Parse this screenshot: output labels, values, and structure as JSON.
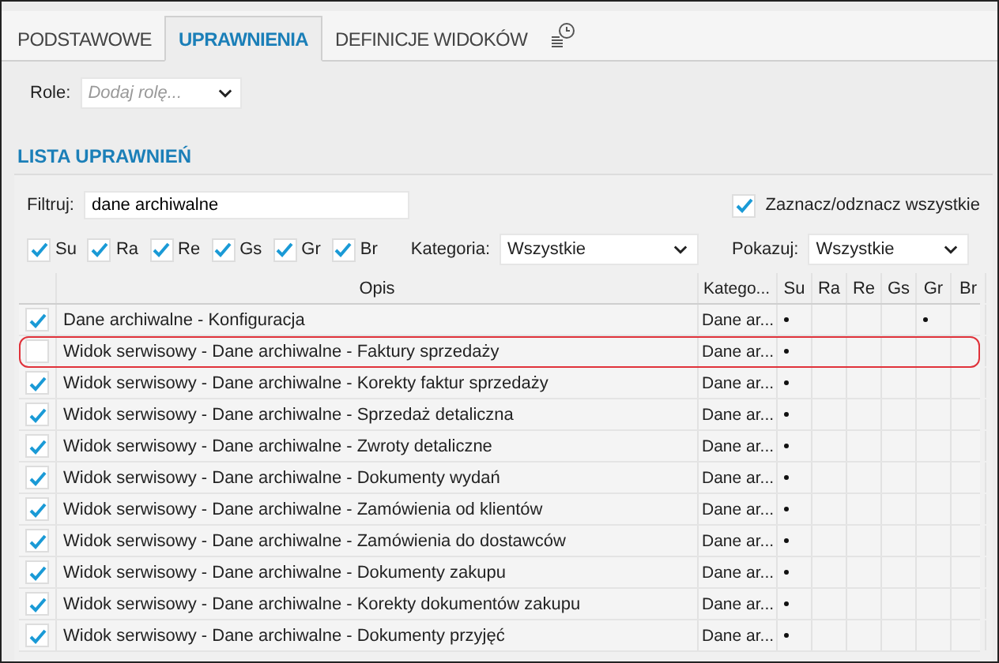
{
  "tabs": [
    {
      "label": "PODSTAWOWE",
      "selected": false
    },
    {
      "label": "UPRAWNIENIA",
      "selected": true
    },
    {
      "label": "DEFINICJE WIDOKÓW",
      "selected": false
    }
  ],
  "role": {
    "label": "Role:",
    "placeholder": "Dodaj rolę..."
  },
  "section_title": "LISTA UPRAWNIEŃ",
  "filter": {
    "label": "Filtruj:",
    "value": "dane archiwalne"
  },
  "select_all": {
    "label": "Zaznacz/odznacz wszystkie",
    "checked": true
  },
  "flags": [
    {
      "label": "Su",
      "checked": true
    },
    {
      "label": "Ra",
      "checked": true
    },
    {
      "label": "Re",
      "checked": true
    },
    {
      "label": "Gs",
      "checked": true
    },
    {
      "label": "Gr",
      "checked": true
    },
    {
      "label": "Br",
      "checked": true
    }
  ],
  "category": {
    "label": "Kategoria:",
    "value": "Wszystkie"
  },
  "show": {
    "label": "Pokazuj:",
    "value": "Wszystkie"
  },
  "table": {
    "columns": [
      "Opis",
      "Katego...",
      "Su",
      "Ra",
      "Re",
      "Gs",
      "Gr",
      "Br"
    ],
    "rows": [
      {
        "checked": true,
        "highlighted": false,
        "description": "Dane archiwalne - Konfiguracja",
        "category": "Dane ar...",
        "marks": [
          true,
          false,
          false,
          false,
          true,
          false
        ]
      },
      {
        "checked": false,
        "highlighted": true,
        "description": "Widok serwisowy - Dane archiwalne - Faktury sprzedaży",
        "category": "Dane ar...",
        "marks": [
          true,
          false,
          false,
          false,
          false,
          false
        ]
      },
      {
        "checked": true,
        "highlighted": false,
        "description": "Widok serwisowy - Dane archiwalne - Korekty faktur sprzedaży",
        "category": "Dane ar...",
        "marks": [
          true,
          false,
          false,
          false,
          false,
          false
        ]
      },
      {
        "checked": true,
        "highlighted": false,
        "description": "Widok serwisowy - Dane archiwalne - Sprzedaż detaliczna",
        "category": "Dane ar...",
        "marks": [
          true,
          false,
          false,
          false,
          false,
          false
        ]
      },
      {
        "checked": true,
        "highlighted": false,
        "description": "Widok serwisowy - Dane archiwalne - Zwroty detaliczne",
        "category": "Dane ar...",
        "marks": [
          true,
          false,
          false,
          false,
          false,
          false
        ]
      },
      {
        "checked": true,
        "highlighted": false,
        "description": "Widok serwisowy - Dane archiwalne - Dokumenty wydań",
        "category": "Dane ar...",
        "marks": [
          true,
          false,
          false,
          false,
          false,
          false
        ]
      },
      {
        "checked": true,
        "highlighted": false,
        "description": "Widok serwisowy - Dane archiwalne - Zamówienia od klientów",
        "category": "Dane ar...",
        "marks": [
          true,
          false,
          false,
          false,
          false,
          false
        ]
      },
      {
        "checked": true,
        "highlighted": false,
        "description": "Widok serwisowy - Dane archiwalne - Zamówienia do dostawców",
        "category": "Dane ar...",
        "marks": [
          true,
          false,
          false,
          false,
          false,
          false
        ]
      },
      {
        "checked": true,
        "highlighted": false,
        "description": "Widok serwisowy - Dane archiwalne - Dokumenty zakupu",
        "category": "Dane ar...",
        "marks": [
          true,
          false,
          false,
          false,
          false,
          false
        ]
      },
      {
        "checked": true,
        "highlighted": false,
        "description": "Widok serwisowy - Dane archiwalne - Korekty dokumentów zakupu",
        "category": "Dane ar...",
        "marks": [
          true,
          false,
          false,
          false,
          false,
          false
        ]
      },
      {
        "checked": true,
        "highlighted": false,
        "description": "Widok serwisowy - Dane archiwalne - Dokumenty przyjęć",
        "category": "Dane ar...",
        "marks": [
          true,
          false,
          false,
          false,
          false,
          false
        ]
      }
    ]
  }
}
